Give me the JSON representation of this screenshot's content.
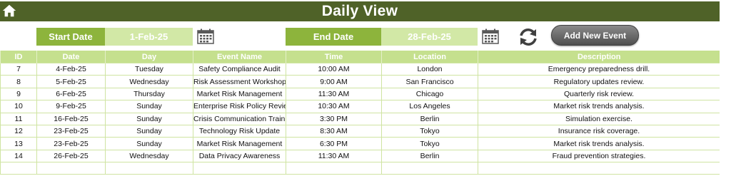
{
  "header": {
    "title": "Daily View",
    "home_icon": "home-icon"
  },
  "filters": {
    "start_label": "Start Date",
    "start_value": "1-Feb-25",
    "end_label": "End Date",
    "end_value": "28-Feb-25",
    "add_button": "Add New Event"
  },
  "colors": {
    "title_bar": "#4f6228",
    "label_green": "#8db43c",
    "value_green": "#d2e8a6",
    "header_green": "#c5e08e"
  },
  "table": {
    "columns": [
      "ID",
      "Date",
      "Day",
      "Event Name",
      "Time",
      "Location",
      "Description"
    ],
    "rows": [
      [
        "7",
        "4-Feb-25",
        "Tuesday",
        "Safety Compliance Audit",
        "10:00 AM",
        "London",
        "Emergency preparedness drill."
      ],
      [
        "8",
        "5-Feb-25",
        "Wednesday",
        "Risk Assessment Workshop",
        "9:00 AM",
        "San Francisco",
        "Regulatory updates review."
      ],
      [
        "9",
        "6-Feb-25",
        "Thursday",
        "Market Risk Management",
        "11:30 AM",
        "Chicago",
        "Quarterly risk review."
      ],
      [
        "10",
        "9-Feb-25",
        "Sunday",
        "Enterprise Risk Policy Review",
        "10:30 AM",
        "Los Angeles",
        "Market risk trends analysis."
      ],
      [
        "11",
        "16-Feb-25",
        "Sunday",
        "Crisis Communication Training",
        "3:30 PM",
        "Berlin",
        "Simulation exercise."
      ],
      [
        "12",
        "23-Feb-25",
        "Sunday",
        "Technology Risk Update",
        "8:30 AM",
        "Tokyo",
        "Insurance risk coverage."
      ],
      [
        "13",
        "23-Feb-25",
        "Sunday",
        "Market Risk Management",
        "6:30 PM",
        "Tokyo",
        "Market risk trends analysis."
      ],
      [
        "14",
        "26-Feb-25",
        "Wednesday",
        "Data Privacy Awareness",
        "11:30 AM",
        "Berlin",
        "Fraud prevention strategies."
      ]
    ]
  }
}
